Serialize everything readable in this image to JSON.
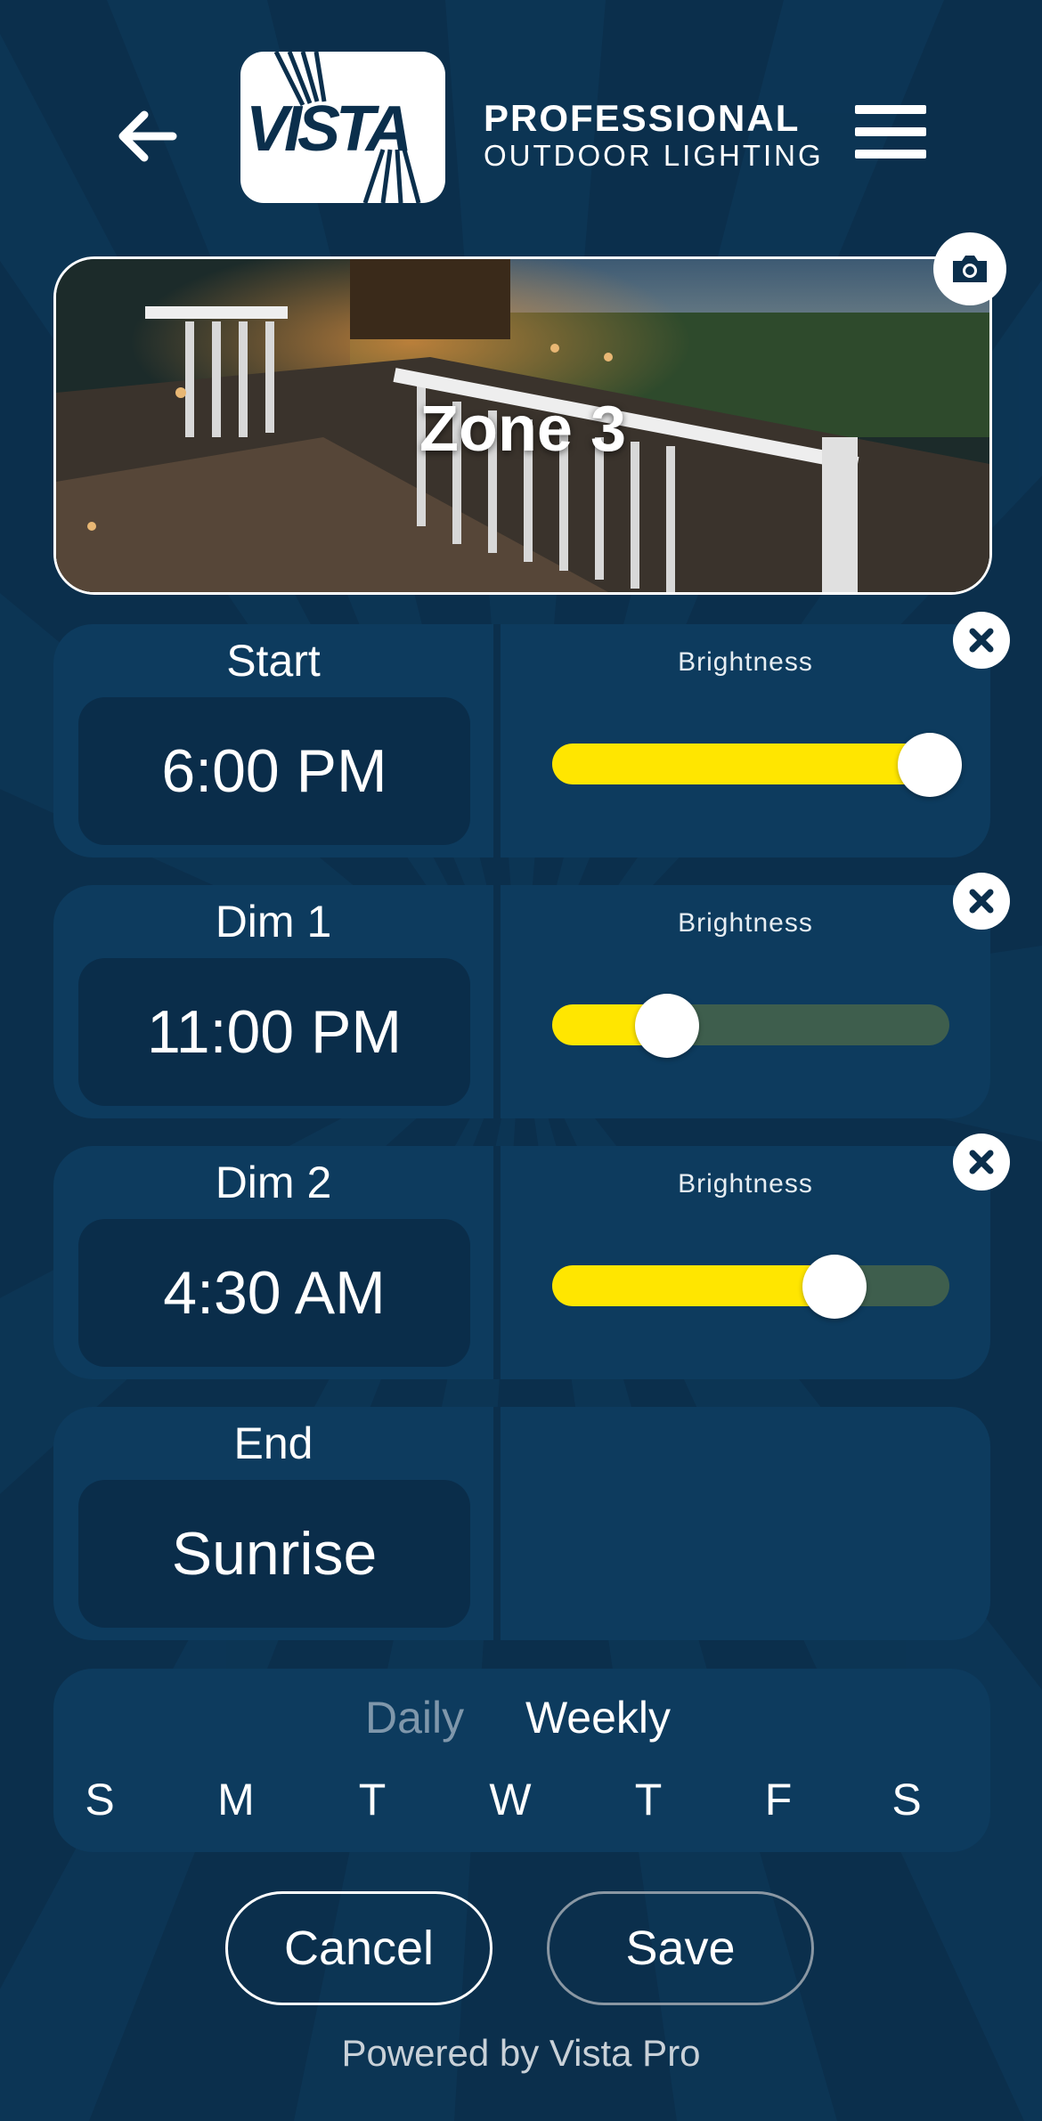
{
  "header": {
    "back_icon": "arrow-left-icon",
    "logo_word": "VISTA",
    "logo_line1": "PROFESSIONAL",
    "logo_line2": "OUTDOOR LIGHTING",
    "menu_icon": "hamburger-menu-icon"
  },
  "zone": {
    "title": "Zone 3",
    "camera_icon": "camera-icon"
  },
  "schedule": [
    {
      "label": "Start",
      "time": "6:00 PM",
      "brightness_label": "Brightness",
      "brightness": 0.95,
      "removable": true
    },
    {
      "label": "Dim 1",
      "time": "11:00 PM",
      "brightness_label": "Brightness",
      "brightness": 0.29,
      "removable": true
    },
    {
      "label": "Dim 2",
      "time": "4:30 AM",
      "brightness_label": "Brightness",
      "brightness": 0.71,
      "removable": true
    },
    {
      "label": "End",
      "time": "Sunrise"
    }
  ],
  "frequency": {
    "tabs": [
      "Daily",
      "Weekly"
    ],
    "selected": "Weekly",
    "days": [
      "S",
      "M",
      "T",
      "W",
      "T",
      "F",
      "S"
    ]
  },
  "actions": {
    "cancel_label": "Cancel",
    "save_label": "Save"
  },
  "footer": "Powered by Vista Pro",
  "colors": {
    "background": "#0b2f4c",
    "card": "#0d3b5e",
    "slider_fill": "#ffe600",
    "slider_track": "#3e5e4d",
    "tab_inactive": "#7f97ab"
  }
}
